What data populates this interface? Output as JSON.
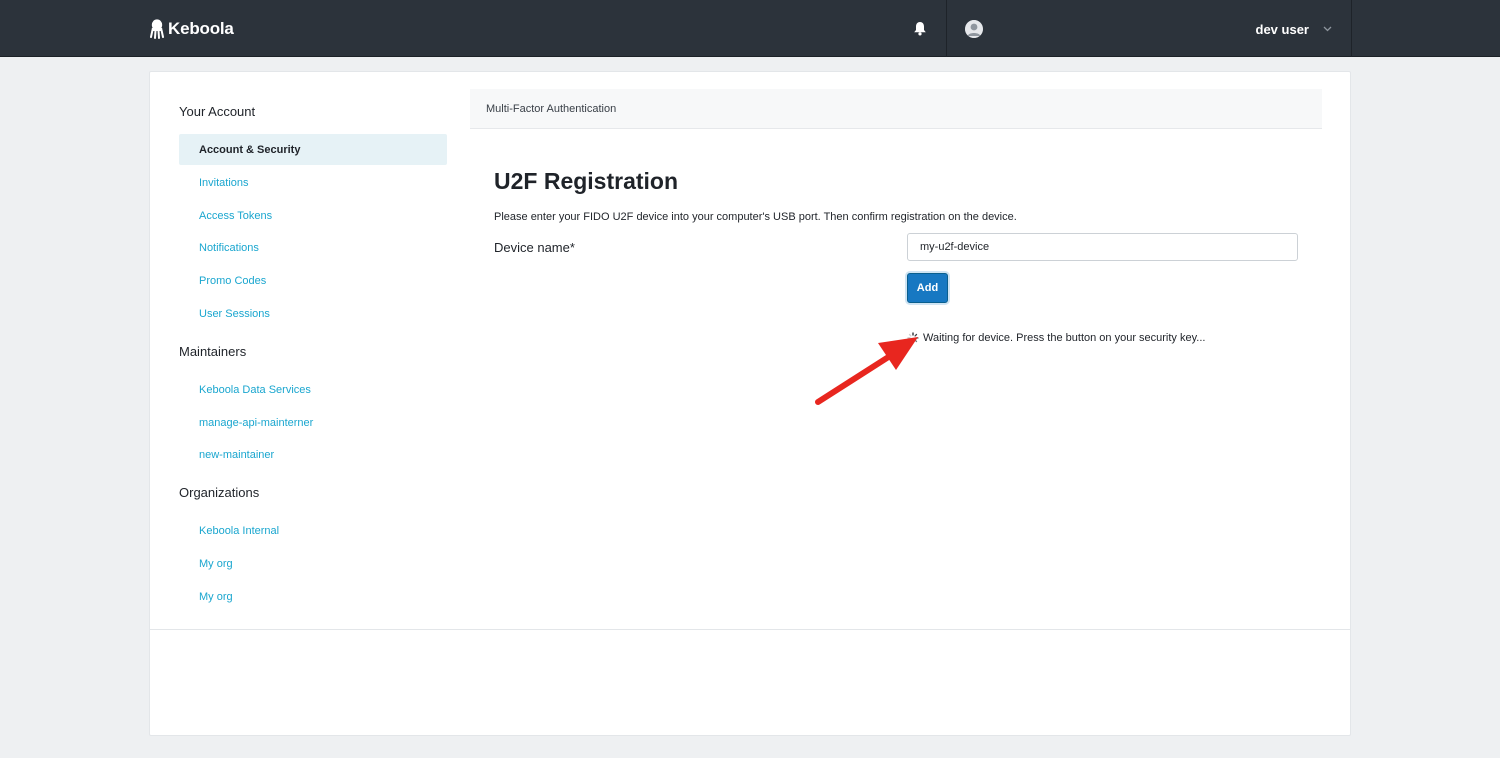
{
  "app": {
    "name": "Keboola"
  },
  "header": {
    "user_name": "dev user"
  },
  "sidebar": {
    "sections": [
      {
        "heading": "Your Account",
        "items": [
          {
            "label": "Account & Security",
            "active": true
          },
          {
            "label": "Invitations"
          },
          {
            "label": "Access Tokens"
          },
          {
            "label": "Notifications"
          },
          {
            "label": "Promo Codes"
          },
          {
            "label": "User Sessions"
          }
        ]
      },
      {
        "heading": "Maintainers",
        "items": [
          {
            "label": "Keboola Data Services"
          },
          {
            "label": "manage-api-mainterner"
          },
          {
            "label": "new-maintainer"
          }
        ]
      },
      {
        "heading": "Organizations",
        "items": [
          {
            "label": "Keboola Internal"
          },
          {
            "label": "My org"
          },
          {
            "label": "My org"
          }
        ]
      }
    ]
  },
  "main": {
    "section_header": "Multi-Factor Authentication",
    "title": "U2F Registration",
    "description": "Please enter your FIDO U2F device into your computer's USB port. Then confirm registration on the device.",
    "device_name_label": "Device name*",
    "device_name_value": "my-u2f-device",
    "add_button_label": "Add",
    "waiting_text": "Waiting for device. Press the button on your security key..."
  },
  "colors": {
    "topbar": "#2c333b",
    "link": "#1aa6cf",
    "active_item_bg": "#e6f2f6",
    "primary_button": "#1778c2",
    "annotation_arrow": "#e8261f"
  },
  "icons": {
    "logo": "keboola-octopus-icon",
    "notifications": "bell-icon",
    "avatar": "user-avatar-icon",
    "user_menu": "chevron-down-icon",
    "status": "spinner-icon"
  }
}
